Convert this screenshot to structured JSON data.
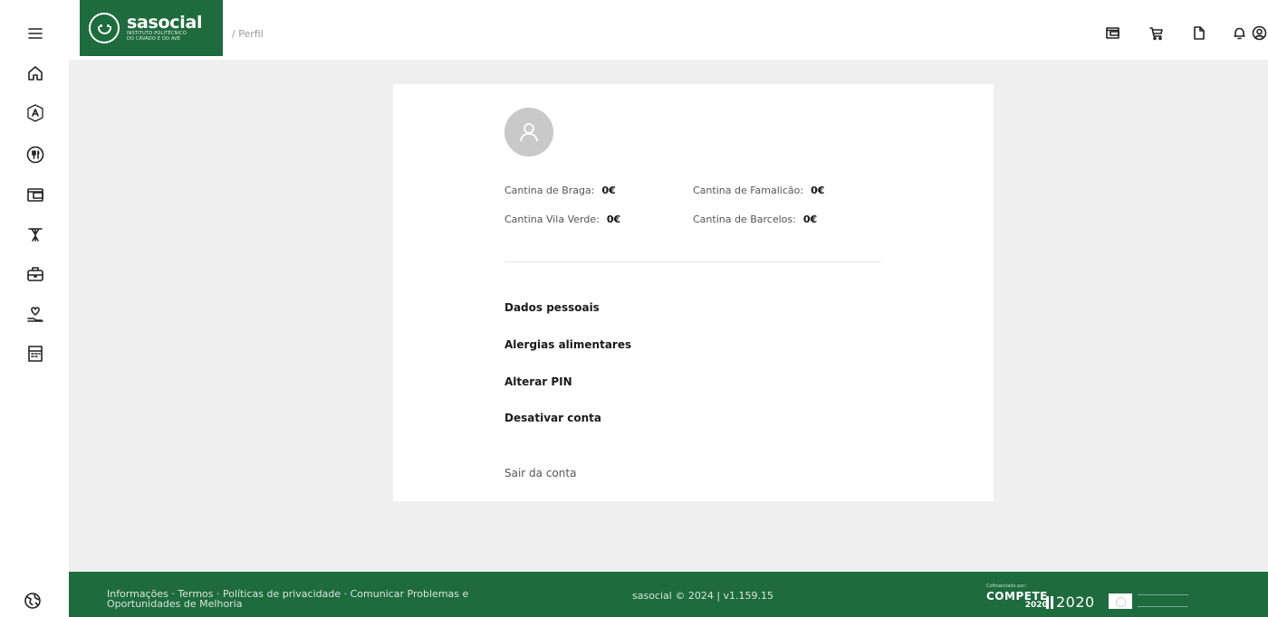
{
  "brand": {
    "name": "sasocial",
    "subtitle_line1": "INSTITUTO POLITÉCNICO",
    "subtitle_line2": "DO CÁVADO E DO AVE"
  },
  "breadcrumb": "/ Perfil",
  "balances": [
    {
      "label": "Cantina de Braga:",
      "value": "0€"
    },
    {
      "label": "Cantina de Famalicão:",
      "value": "0€"
    },
    {
      "label": "Cantina Vila Verde:",
      "value": "0€"
    },
    {
      "label": "Cantina de Barcelos:",
      "value": "0€"
    }
  ],
  "menu": [
    {
      "label": "Dados pessoais"
    },
    {
      "label": "Alergias alimentares"
    },
    {
      "label": "Alterar PIN"
    },
    {
      "label": "Desativar conta"
    }
  ],
  "logout_label": "Sair da conta",
  "footer": {
    "links": [
      "Informações",
      "Termos",
      "Políticas de privacidade",
      "Comunicar Problemas e Oportunidades de Melhoria"
    ],
    "separator": " · ",
    "copyright": "sasocial © 2024 | v1.159.15",
    "funded_by": "Cofinanciado por:",
    "compete": "COMPETE",
    "compete_year": "2020",
    "portugal2020": "2020"
  },
  "icons": {
    "sidebar": [
      "menu-icon",
      "home-icon",
      "accommodation-icon",
      "food-icon",
      "wallet-icon",
      "mobility-icon",
      "jobs-icon",
      "social-support-icon",
      "calendar-icon"
    ],
    "header": [
      "wallet-icon",
      "cart-icon",
      "document-icon",
      "bell-icon",
      "user-icon"
    ],
    "footer": "globe-icon"
  },
  "colors": {
    "brand_green": "#1e6b3e",
    "background": "#efefef"
  }
}
